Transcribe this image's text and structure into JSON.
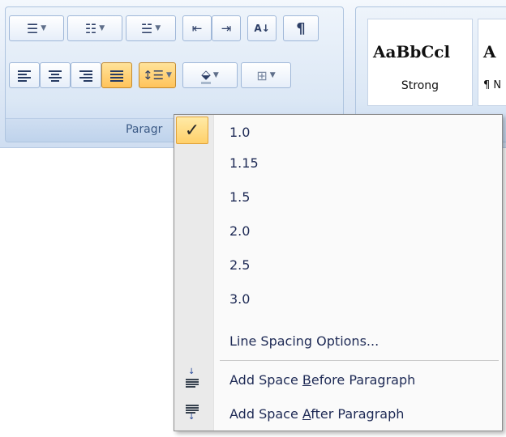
{
  "ribbon": {
    "paragraph_group": {
      "label": "Paragr",
      "buttons": {
        "bullets": "bullets-icon",
        "numbering": "numbering-icon",
        "multilevel": "multilevel-list-icon",
        "decrease_indent": "decrease-indent-icon",
        "increase_indent": "increase-indent-icon",
        "sort": "sort-icon",
        "show_marks": "¶",
        "align_left": "align-left-icon",
        "center": "align-center-icon",
        "align_right": "align-right-icon",
        "justify": "justify-icon",
        "line_spacing": "line-spacing-icon",
        "shading": "shading-icon",
        "borders": "borders-icon"
      }
    },
    "styles": {
      "strong_sample": "AaBbCcl",
      "strong_name": "Strong",
      "normal_sample": "A",
      "normal_name": "¶ N"
    }
  },
  "line_spacing_menu": {
    "checked": "1.0",
    "items": [
      {
        "label": "1.0"
      },
      {
        "label": "1.15"
      },
      {
        "label": "1.5"
      },
      {
        "label": "2.0"
      },
      {
        "label": "2.5"
      },
      {
        "label": "3.0"
      }
    ],
    "options_label": "Line Spacing Options...",
    "add_before": {
      "pre": "Add Space ",
      "key": "B",
      "post": "efore Paragraph"
    },
    "add_after": {
      "pre": "Add Space ",
      "key": "A",
      "post": "fter Paragraph"
    }
  },
  "colors": {
    "accent_active": "#ffc35a",
    "menu_text": "#1e2a55",
    "ribbon_label": "#3b5a86"
  }
}
